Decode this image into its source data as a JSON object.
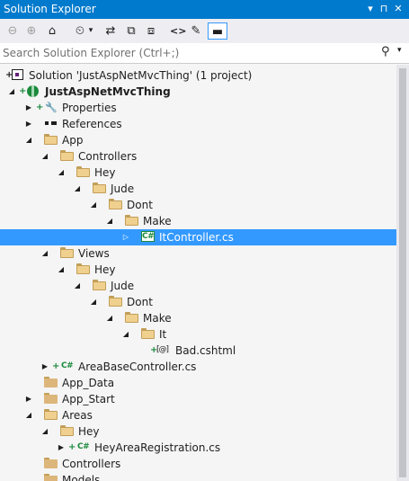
{
  "titlebar": {
    "title": "Solution Explorer",
    "pin_glyph": "▾",
    "autohide_glyph": "⊓",
    "close_glyph": "✕"
  },
  "toolbar": {
    "back_glyph": "⊖",
    "forward_glyph": "⊕",
    "home_glyph": "⌂",
    "history_glyph": "⏲",
    "history_dropdown_glyph": "▾",
    "sync_glyph": "⇄",
    "collapse_glyph": "⧉",
    "showall_glyph": "⧈",
    "code_glyph": "<>",
    "properties_glyph": "✎",
    "preview_glyph": "▬"
  },
  "search": {
    "placeholder": "Search Solution Explorer (Ctrl+;)",
    "value": "",
    "icon_glyph": "⚲",
    "dropdown_glyph": "▾"
  },
  "tree": {
    "rows": [
      {
        "label": "Solution 'JustAspNetMvcThing' (1 project)",
        "icon": "solution-icon",
        "mark": "+",
        "depth": 0
      },
      {
        "label": "JustAspNetMvcThing",
        "icon": "web-project-icon",
        "mark": "+",
        "expanded": true,
        "bold": true
      },
      {
        "label": "Properties",
        "icon": "wrench-icon",
        "mark": "+",
        "expanded": false
      },
      {
        "label": "References",
        "icon": "references-icon",
        "expanded": false
      },
      {
        "label": "App",
        "icon": "folder-open-icon",
        "expanded": true
      },
      {
        "label": "Controllers",
        "icon": "folder-open-icon",
        "expanded": true
      },
      {
        "label": "Hey",
        "icon": "folder-open-icon",
        "expanded": true
      },
      {
        "label": "Jude",
        "icon": "folder-open-icon",
        "expanded": true
      },
      {
        "label": "Dont",
        "icon": "folder-open-icon",
        "expanded": true
      },
      {
        "label": "Make",
        "icon": "folder-open-icon",
        "expanded": true
      },
      {
        "label": "ItController.cs",
        "icon": "csharp-file-icon",
        "expanded": false,
        "selected": true
      },
      {
        "label": "Views",
        "icon": "folder-open-icon",
        "expanded": true
      },
      {
        "label": "Hey",
        "icon": "folder-open-icon",
        "expanded": true
      },
      {
        "label": "Jude",
        "icon": "folder-open-icon",
        "expanded": true
      },
      {
        "label": "Dont",
        "icon": "folder-open-icon",
        "expanded": true
      },
      {
        "label": "Make",
        "icon": "folder-open-icon",
        "expanded": true
      },
      {
        "label": "It",
        "icon": "folder-open-icon",
        "expanded": true
      },
      {
        "label": "Bad.cshtml",
        "icon": "razor-file-icon",
        "mark": "+"
      },
      {
        "label": "AreaBaseController.cs",
        "icon": "csharp-file-icon",
        "mark": "+",
        "expanded": false
      },
      {
        "label": "App_Data",
        "icon": "folder-icon"
      },
      {
        "label": "App_Start",
        "icon": "folder-icon",
        "expanded": false
      },
      {
        "label": "Areas",
        "icon": "folder-open-icon",
        "expanded": true
      },
      {
        "label": "Hey",
        "icon": "folder-open-icon",
        "expanded": true
      },
      {
        "label": "HeyAreaRegistration.cs",
        "icon": "csharp-file-icon",
        "mark": "+",
        "expanded": false
      },
      {
        "label": "Controllers",
        "icon": "folder-icon"
      },
      {
        "label": "Models",
        "icon": "folder-icon"
      }
    ]
  },
  "colors": {
    "accent": "#007acc",
    "selection": "#3399ff",
    "added_mark": "#1b8a3c",
    "folder": "#dcb67a",
    "background": "#f5f5f5"
  },
  "glyphs": {
    "expanded": "◢",
    "collapsed": "▷",
    "collapsed_dark": "▶",
    "csharp": "C#",
    "razor": "[@]",
    "wrench": "🔧"
  }
}
